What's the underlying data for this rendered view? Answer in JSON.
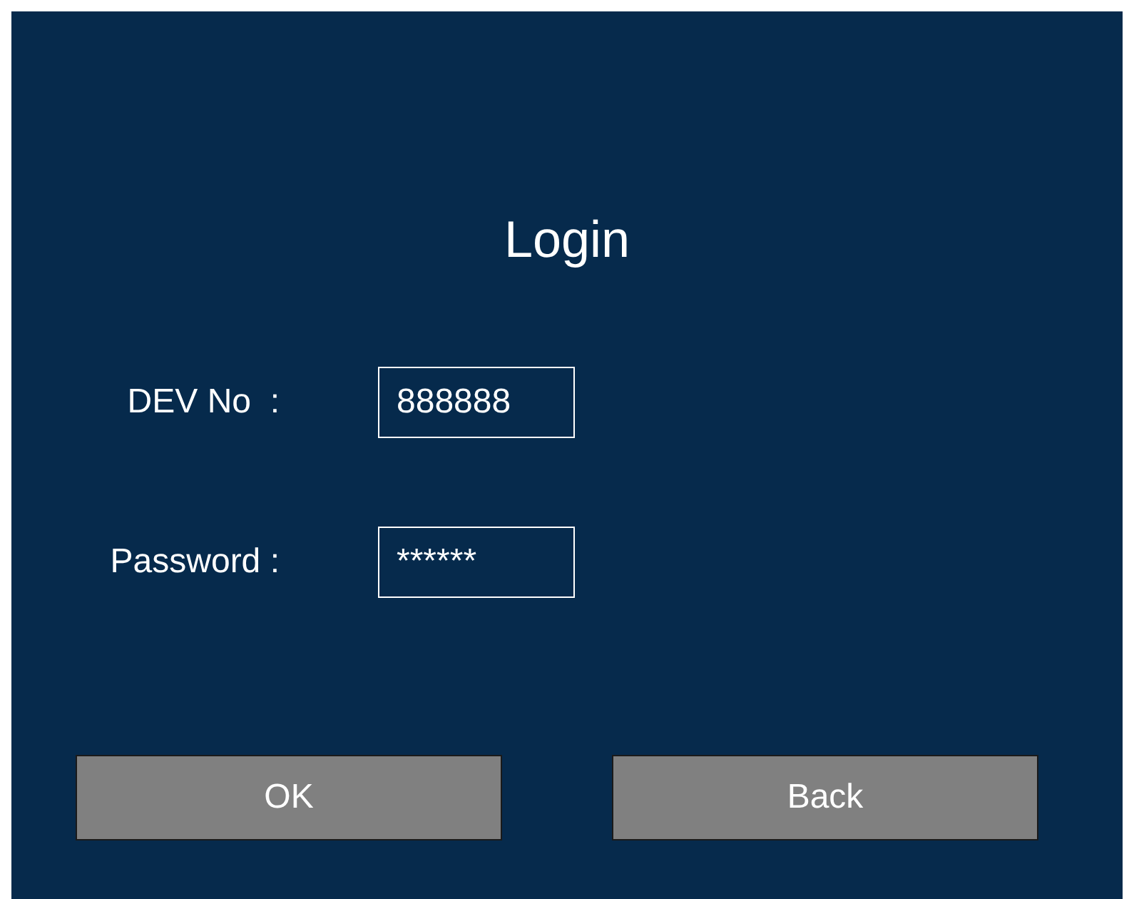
{
  "title": "Login",
  "fields": [
    {
      "label": "DEV No  :",
      "value": "888888"
    },
    {
      "label": "Password :",
      "value": "******"
    }
  ],
  "buttons": [
    "OK",
    "Back"
  ]
}
